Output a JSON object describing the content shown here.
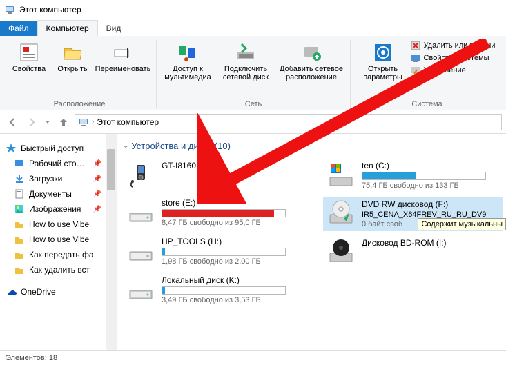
{
  "window": {
    "title": "Этот компьютер"
  },
  "tabs": {
    "file": "Файл",
    "computer": "Компьютер",
    "view": "Вид"
  },
  "ribbon": {
    "location": {
      "label": "Расположение",
      "properties": "Свойства",
      "open": "Открыть",
      "rename": "Переименовать"
    },
    "network": {
      "label": "Сеть",
      "media": "Доступ к мультимедиа",
      "map": "Подключить сетевой диск",
      "add": "Добавить сетевое расположение"
    },
    "system": {
      "label": "Система",
      "open_params": "Открыть параметры",
      "remove": "Удалить или измени",
      "sysprops": "Свойства системы",
      "manage": "Управление"
    }
  },
  "address": {
    "location": "Этот компьютер"
  },
  "sidebar": {
    "quick": "Быстрый доступ",
    "items": [
      "Рабочий сто…",
      "Загрузки",
      "Документы",
      "Изображения",
      "How to use Vibe",
      "How to use Vibe",
      "Как передать фа",
      "Как удалить вст"
    ],
    "onedrive": "OneDrive"
  },
  "section": {
    "title": "Устройства и диски (10)"
  },
  "devices_left": [
    {
      "name": "GT-I8160",
      "type": "media",
      "bar": false
    },
    {
      "name": "store (E:)",
      "sub": "8,47 ГБ свободно из 95,0 ГБ",
      "fill": 91,
      "color": "#d22",
      "bar": true
    },
    {
      "name": "HP_TOOLS (H:)",
      "sub": "1,98 ГБ свободно из 2,00 ГБ",
      "fill": 2,
      "color": "#26a0da",
      "bar": true
    },
    {
      "name": "Локальный диск (K:)",
      "sub": "3,49 ГБ свободно из 3,53 ГБ",
      "fill": 2,
      "color": "#26a0da",
      "bar": true
    }
  ],
  "devices_right": [
    {
      "name": "ten (C:)",
      "sub": "75,4 ГБ свободно из 133 ГБ",
      "fill": 43,
      "color": "#26a0da",
      "bar": true,
      "type": "win"
    },
    {
      "name": "DVD RW дисковод (F:)",
      "name2": "IR5_CENA_X64FREV_RU_RU_DV9",
      "sub": "0 байт своб",
      "bar": false,
      "type": "dvd",
      "sel": true
    },
    {
      "name": "Дисковод BD-ROM (I:)",
      "bar": false,
      "type": "bd"
    }
  ],
  "tooltip": "Содержит музыкальны",
  "status": {
    "count": "Элементов: 18"
  }
}
